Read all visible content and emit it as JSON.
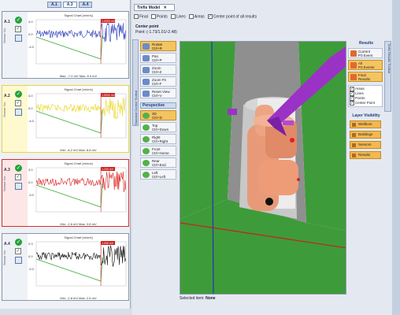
{
  "left": {
    "tabs": [
      "A.1",
      "A.3",
      "A.4"
    ],
    "channels": [
      {
        "id": "A.1",
        "sensor": "Sensor No.",
        "title": "Signal Chart [m/m/s]",
        "minmax": "Max: -7.0 mV  Max: 8.9 mV",
        "ytop": "4.0",
        "ymid": "0.0",
        "ybot": "-4.0",
        "redlabel": "1.0000 mV",
        "color": "#2a3bb8",
        "bg": "#ffffff",
        "border": "#8a96a8",
        "rail": "#eef1f5"
      },
      {
        "id": "A.2",
        "sensor": "Sensor No.",
        "title": "Signal Chart [m/m/s]",
        "minmax": "Min: -8.2 mV  Max: 8.8 mV",
        "ytop": "4.0",
        "ymid": "0.0",
        "ybot": "-4.0",
        "redlabel": "1.5000 mV",
        "color": "#e8d828",
        "bg": "#ffffff",
        "border": "#e8d640",
        "rail": "#fff9d0"
      },
      {
        "id": "A.3",
        "sensor": "Sensor No.",
        "title": "Signal Chart [m/m/s]",
        "minmax": "Min: -2.6 mV  Max: 3.8 mV",
        "ytop": "3.0",
        "ymid": "0.0",
        "ybot": "-3.0",
        "redlabel": "1.200 mV",
        "color": "#d82020",
        "bg": "#ffffff",
        "border": "#d03030",
        "rail": "#fde6e6"
      },
      {
        "id": "A.4",
        "sensor": "Sensor No.",
        "title": "Signal Chart [m/m/s]",
        "minmax": "Min: -2.8 mV  Max: 2.6 mV",
        "ytop": "0.3",
        "ymid": "0.0",
        "ybot": "-0.3",
        "redlabel": "1.000 mV",
        "color": "#111111",
        "bg": "#ffffff",
        "border": "#8a96a8",
        "rail": "#eef1f5"
      }
    ]
  },
  "main": {
    "tab_label": "Trefis Model",
    "filters": [
      "Final",
      "Points",
      "Lines",
      "Areas",
      "Center point of all results"
    ],
    "center_point_label": "Center point",
    "center_point_value": "Point: (-1.73/1.01/-2.48)",
    "status_label": "Selected item:",
    "status_value": "None"
  },
  "toolbar": {
    "side_label": "Standard Control Toolbar",
    "buttons": [
      {
        "label": "Rotate\nCtrl+R",
        "active": true
      },
      {
        "label": "Pan\nCtrl+P",
        "active": false
      },
      {
        "label": "Zoom\nCtrl+Z",
        "active": false
      },
      {
        "label": "Zoom Fit\nCtrl+F",
        "active": false
      },
      {
        "label": "Reset View\nCtrl+V",
        "active": false
      }
    ],
    "perspective_label": "Perspective",
    "views": [
      {
        "label": "3D\nCtrl+D",
        "active": true
      },
      {
        "label": "Top\nCtrl+Down",
        "active": false
      },
      {
        "label": "Right\nCtrl+Right",
        "active": false
      },
      {
        "label": "Front\nCtrl+Home",
        "active": false
      },
      {
        "label": "Rear\nCtrl+End",
        "active": false
      },
      {
        "label": "Left\nCtrl+Left",
        "active": false
      }
    ]
  },
  "results": {
    "header": "Results",
    "side_label": "Trefis Results Toolbar",
    "buttons": [
      {
        "label": "Current\nP3 Event",
        "active": false
      },
      {
        "label": "All\nP3 Events",
        "active": true
      },
      {
        "label": "Final\nResults",
        "active": true
      }
    ],
    "list": [
      "Areas",
      "Lines",
      "Points",
      "Center Point"
    ],
    "layer_header": "Layer Visibility",
    "layers": [
      "Wellbore",
      "Buildings",
      "Sensors",
      "Results"
    ]
  },
  "colors": {
    "accent": "#f3c460",
    "ground": "#3a9a3a",
    "body": "#e8a07a",
    "probe": "#9b32c6",
    "axis_blue": "#2233bb",
    "axis_red": "#c82020"
  }
}
